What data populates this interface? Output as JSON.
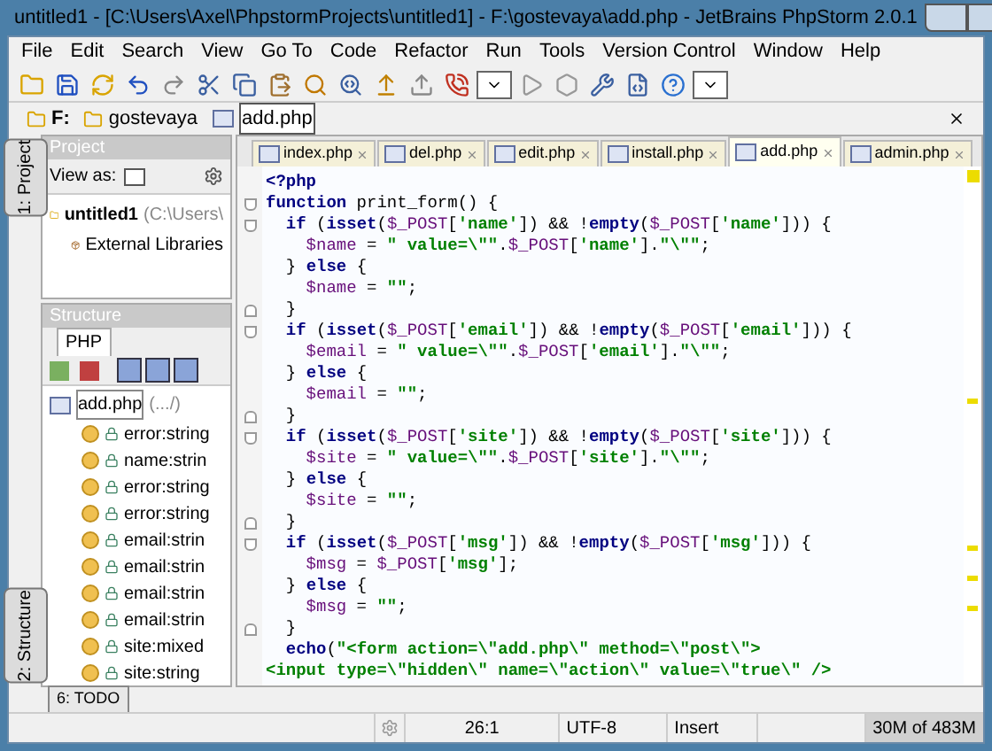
{
  "window": {
    "title": "untitled1 - [C:\\Users\\Axel\\PhpstormProjects\\untitled1] - F:\\gostevaya\\add.php - JetBrains PhpStorm 2.0.1"
  },
  "menu": [
    "File",
    "Edit",
    "Search",
    "View",
    "Go To",
    "Code",
    "Refactor",
    "Run",
    "Tools",
    "Version Control",
    "Window",
    "Help"
  ],
  "breadcrumbs": [
    {
      "label": "F:",
      "kind": "folder"
    },
    {
      "label": "gostevaya",
      "kind": "folder"
    },
    {
      "label": "add.php",
      "kind": "file"
    }
  ],
  "project_panel": {
    "title": "Project",
    "tab": "1: Project",
    "view_as": "View as:",
    "tree": [
      {
        "label": "untitled1",
        "path": "(C:\\Users\\",
        "kind": "project",
        "selected": false
      },
      {
        "label": "External Libraries",
        "kind": "library",
        "selected": false
      }
    ]
  },
  "structure_panel": {
    "title": "Structure",
    "tab": "2: Structure",
    "subtab": "PHP",
    "root": {
      "label": "add.php",
      "path": "(.../)",
      "selected": true,
      "children": [
        {
          "label": "error:string",
          "selected": false
        },
        {
          "label": "name:strin",
          "selected": false
        },
        {
          "label": "error:string",
          "selected": false
        },
        {
          "label": "error:string",
          "selected": false
        },
        {
          "label": "email:strin",
          "selected": false
        },
        {
          "label": "email:strin",
          "selected": false
        },
        {
          "label": "email:strin",
          "selected": false
        },
        {
          "label": "email:strin",
          "selected": false
        },
        {
          "label": "site:mixed",
          "selected": false
        },
        {
          "label": "site:string",
          "selected": false
        }
      ]
    }
  },
  "tabs": [
    {
      "label": "index.php",
      "selected": false
    },
    {
      "label": "del.php",
      "selected": false
    },
    {
      "label": "edit.php",
      "selected": false
    },
    {
      "label": "install.php",
      "selected": false
    },
    {
      "label": "add.php",
      "selected": true
    },
    {
      "label": "admin.php",
      "selected": false
    }
  ],
  "code": [
    {
      "kind": "plain",
      "parts": [
        {
          "kind": "tag",
          "text": "<?php"
        }
      ]
    },
    {
      "kind": "fold_start",
      "parts": [
        {
          "kind": "kw",
          "text": "function"
        },
        {
          "kind": "plain",
          "text": " print_form() {"
        }
      ]
    },
    {
      "kind": "fold_start",
      "parts": [
        {
          "kind": "kw",
          "text": "  if"
        },
        {
          "kind": "plain",
          "text": " ("
        },
        {
          "kind": "kw",
          "text": "isset"
        },
        {
          "kind": "plain",
          "text": "("
        },
        {
          "kind": "var",
          "text": "$_POST"
        },
        {
          "kind": "plain",
          "text": "["
        },
        {
          "kind": "str",
          "text": "'name'"
        },
        {
          "kind": "plain",
          "text": "]) && !"
        },
        {
          "kind": "kw",
          "text": "empty"
        },
        {
          "kind": "plain",
          "text": "("
        },
        {
          "kind": "var",
          "text": "$_POST"
        },
        {
          "kind": "plain",
          "text": "["
        },
        {
          "kind": "str",
          "text": "'name'"
        },
        {
          "kind": "plain",
          "text": "])) {"
        }
      ]
    },
    {
      "kind": "plain",
      "parts": [
        {
          "kind": "var",
          "text": "    $name"
        },
        {
          "kind": "plain",
          "text": " = "
        },
        {
          "kind": "str",
          "text": "\" value=\\\"\""
        },
        {
          "kind": "plain",
          "text": "."
        },
        {
          "kind": "var",
          "text": "$_POST"
        },
        {
          "kind": "plain",
          "text": "["
        },
        {
          "kind": "str",
          "text": "'name'"
        },
        {
          "kind": "plain",
          "text": "]."
        },
        {
          "kind": "str",
          "text": "\"\\\"\""
        },
        {
          "kind": "plain",
          "text": ";"
        }
      ]
    },
    {
      "kind": "plain",
      "parts": [
        {
          "kind": "plain",
          "text": "  } "
        },
        {
          "kind": "kw",
          "text": "else"
        },
        {
          "kind": "plain",
          "text": " {"
        }
      ]
    },
    {
      "kind": "plain",
      "parts": [
        {
          "kind": "var",
          "text": "    $name"
        },
        {
          "kind": "plain",
          "text": " = "
        },
        {
          "kind": "str",
          "text": "\"\""
        },
        {
          "kind": "plain",
          "text": ";"
        }
      ]
    },
    {
      "kind": "fold_end",
      "parts": [
        {
          "kind": "plain",
          "text": "  }"
        }
      ]
    },
    {
      "kind": "fold_start",
      "parts": [
        {
          "kind": "kw",
          "text": "  if"
        },
        {
          "kind": "plain",
          "text": " ("
        },
        {
          "kind": "kw",
          "text": "isset"
        },
        {
          "kind": "plain",
          "text": "("
        },
        {
          "kind": "var",
          "text": "$_POST"
        },
        {
          "kind": "plain",
          "text": "["
        },
        {
          "kind": "str",
          "text": "'email'"
        },
        {
          "kind": "plain",
          "text": "]) && !"
        },
        {
          "kind": "kw",
          "text": "empty"
        },
        {
          "kind": "plain",
          "text": "("
        },
        {
          "kind": "var",
          "text": "$_POST"
        },
        {
          "kind": "plain",
          "text": "["
        },
        {
          "kind": "str",
          "text": "'email'"
        },
        {
          "kind": "plain",
          "text": "])) {"
        }
      ]
    },
    {
      "kind": "plain",
      "parts": [
        {
          "kind": "var",
          "text": "    $email"
        },
        {
          "kind": "plain",
          "text": " = "
        },
        {
          "kind": "str",
          "text": "\" value=\\\"\""
        },
        {
          "kind": "plain",
          "text": "."
        },
        {
          "kind": "var",
          "text": "$_POST"
        },
        {
          "kind": "plain",
          "text": "["
        },
        {
          "kind": "str",
          "text": "'email'"
        },
        {
          "kind": "plain",
          "text": "]."
        },
        {
          "kind": "str",
          "text": "\"\\\"\""
        },
        {
          "kind": "plain",
          "text": ";"
        }
      ]
    },
    {
      "kind": "plain",
      "parts": [
        {
          "kind": "plain",
          "text": "  } "
        },
        {
          "kind": "kw",
          "text": "else"
        },
        {
          "kind": "plain",
          "text": " {"
        }
      ]
    },
    {
      "kind": "plain",
      "parts": [
        {
          "kind": "var",
          "text": "    $email"
        },
        {
          "kind": "plain",
          "text": " = "
        },
        {
          "kind": "str",
          "text": "\"\""
        },
        {
          "kind": "plain",
          "text": ";"
        }
      ]
    },
    {
      "kind": "fold_end",
      "parts": [
        {
          "kind": "plain",
          "text": "  }"
        }
      ]
    },
    {
      "kind": "fold_start",
      "parts": [
        {
          "kind": "kw",
          "text": "  if"
        },
        {
          "kind": "plain",
          "text": " ("
        },
        {
          "kind": "kw",
          "text": "isset"
        },
        {
          "kind": "plain",
          "text": "("
        },
        {
          "kind": "var",
          "text": "$_POST"
        },
        {
          "kind": "plain",
          "text": "["
        },
        {
          "kind": "str",
          "text": "'site'"
        },
        {
          "kind": "plain",
          "text": "]) && !"
        },
        {
          "kind": "kw",
          "text": "empty"
        },
        {
          "kind": "plain",
          "text": "("
        },
        {
          "kind": "var",
          "text": "$_POST"
        },
        {
          "kind": "plain",
          "text": "["
        },
        {
          "kind": "str",
          "text": "'site'"
        },
        {
          "kind": "plain",
          "text": "])) {"
        }
      ]
    },
    {
      "kind": "plain",
      "parts": [
        {
          "kind": "var",
          "text": "    $site"
        },
        {
          "kind": "plain",
          "text": " = "
        },
        {
          "kind": "str",
          "text": "\" value=\\\"\""
        },
        {
          "kind": "plain",
          "text": "."
        },
        {
          "kind": "var",
          "text": "$_POST"
        },
        {
          "kind": "plain",
          "text": "["
        },
        {
          "kind": "str",
          "text": "'site'"
        },
        {
          "kind": "plain",
          "text": "]."
        },
        {
          "kind": "str",
          "text": "\"\\\"\""
        },
        {
          "kind": "plain",
          "text": ";"
        }
      ]
    },
    {
      "kind": "plain",
      "parts": [
        {
          "kind": "plain",
          "text": "  } "
        },
        {
          "kind": "kw",
          "text": "else"
        },
        {
          "kind": "plain",
          "text": " {"
        }
      ]
    },
    {
      "kind": "plain",
      "parts": [
        {
          "kind": "var",
          "text": "    $site"
        },
        {
          "kind": "plain",
          "text": " = "
        },
        {
          "kind": "str",
          "text": "\"\""
        },
        {
          "kind": "plain",
          "text": ";"
        }
      ]
    },
    {
      "kind": "fold_end",
      "parts": [
        {
          "kind": "plain",
          "text": "  }"
        }
      ]
    },
    {
      "kind": "fold_start",
      "parts": [
        {
          "kind": "kw",
          "text": "  if"
        },
        {
          "kind": "plain",
          "text": " ("
        },
        {
          "kind": "kw",
          "text": "isset"
        },
        {
          "kind": "plain",
          "text": "("
        },
        {
          "kind": "var",
          "text": "$_POST"
        },
        {
          "kind": "plain",
          "text": "["
        },
        {
          "kind": "str",
          "text": "'msg'"
        },
        {
          "kind": "plain",
          "text": "]) && !"
        },
        {
          "kind": "kw",
          "text": "empty"
        },
        {
          "kind": "plain",
          "text": "("
        },
        {
          "kind": "var",
          "text": "$_POST"
        },
        {
          "kind": "plain",
          "text": "["
        },
        {
          "kind": "str",
          "text": "'msg'"
        },
        {
          "kind": "plain",
          "text": "])) {"
        }
      ]
    },
    {
      "kind": "plain",
      "parts": [
        {
          "kind": "var",
          "text": "    $msg"
        },
        {
          "kind": "plain",
          "text": " = "
        },
        {
          "kind": "var",
          "text": "$_POST"
        },
        {
          "kind": "plain",
          "text": "["
        },
        {
          "kind": "str",
          "text": "'msg'"
        },
        {
          "kind": "plain",
          "text": "];"
        }
      ]
    },
    {
      "kind": "plain",
      "parts": [
        {
          "kind": "plain",
          "text": "  } "
        },
        {
          "kind": "kw",
          "text": "else"
        },
        {
          "kind": "plain",
          "text": " {"
        }
      ]
    },
    {
      "kind": "plain",
      "parts": [
        {
          "kind": "var",
          "text": "    $msg"
        },
        {
          "kind": "plain",
          "text": " = "
        },
        {
          "kind": "str",
          "text": "\"\""
        },
        {
          "kind": "plain",
          "text": ";"
        }
      ]
    },
    {
      "kind": "fold_end",
      "parts": [
        {
          "kind": "plain",
          "text": "  }"
        }
      ]
    },
    {
      "kind": "plain",
      "parts": [
        {
          "kind": "kw",
          "text": "  echo"
        },
        {
          "kind": "plain",
          "text": "("
        },
        {
          "kind": "str",
          "text": "\"<form action=\\\"add.php\\\" method=\\\"post\\\">"
        }
      ]
    },
    {
      "kind": "plain",
      "parts": [
        {
          "kind": "str",
          "text": "<input type=\\\"hidden\\\" name=\\\"action\\\" value=\\\"true\\\" />"
        }
      ]
    }
  ],
  "bottom_tool": "6: TODO",
  "status_bar": {
    "position": "26:1",
    "encoding": "UTF-8",
    "mode": "Insert",
    "memory": "30M of 483M"
  }
}
